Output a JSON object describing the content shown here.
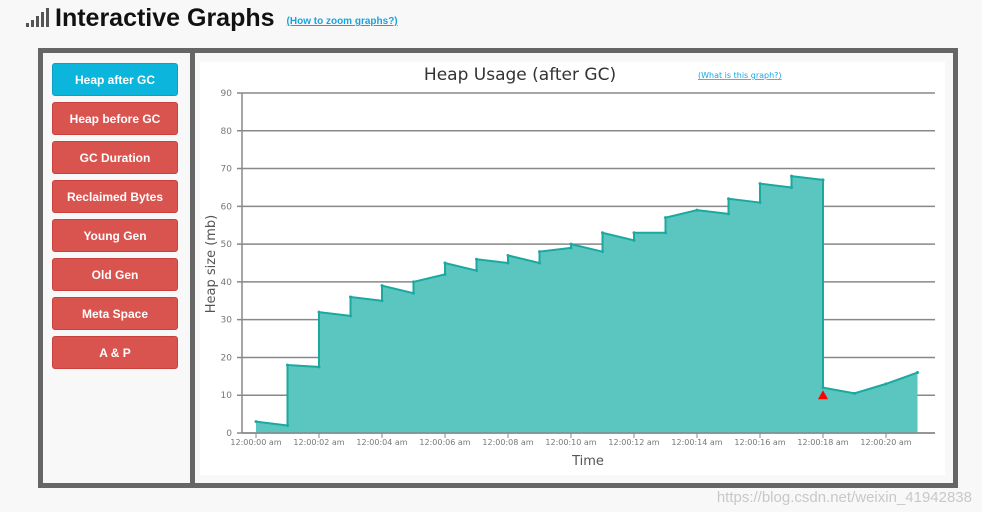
{
  "header": {
    "title": "Interactive Graphs",
    "help_link": "(How to zoom graphs?)"
  },
  "sidebar": {
    "items": [
      {
        "label": "Heap after GC",
        "active": true
      },
      {
        "label": "Heap before GC"
      },
      {
        "label": "GC Duration"
      },
      {
        "label": "Reclaimed Bytes"
      },
      {
        "label": "Young Gen"
      },
      {
        "label": "Old Gen"
      },
      {
        "label": "Meta Space"
      },
      {
        "label": "A & P"
      }
    ]
  },
  "watermark": "https://blog.csdn.net/weixin_41942838",
  "chart_data": {
    "type": "area",
    "title": "Heap Usage (after GC)",
    "help_link": "(What is this graph?)",
    "xlabel": "Time",
    "ylabel": "Heap size (mb)",
    "ylim": [
      0,
      90
    ],
    "yticks": [
      0,
      10,
      20,
      30,
      40,
      50,
      60,
      70,
      80,
      90
    ],
    "xlim_seconds": [
      0,
      21
    ],
    "xticks": [
      "12:00:00 am",
      "12:00:02 am",
      "12:00:04 am",
      "12:00:06 am",
      "12:00:08 am",
      "12:00:10 am",
      "12:00:12 am",
      "12:00:14 am",
      "12:00:16 am",
      "12:00:18 am",
      "12:00:20 am"
    ],
    "grid": true,
    "color": "#5bc6c0",
    "line_color": "#1aa9a0",
    "marker_color": "#ff0000",
    "series": [
      {
        "points": [
          [
            0,
            3
          ],
          [
            1,
            2
          ],
          [
            1,
            18
          ],
          [
            2,
            17.5
          ],
          [
            2,
            32
          ],
          [
            3,
            31
          ],
          [
            3,
            36
          ],
          [
            4,
            35
          ],
          [
            4,
            39
          ],
          [
            5,
            37
          ],
          [
            5,
            40
          ],
          [
            6,
            42
          ],
          [
            6,
            45
          ],
          [
            7,
            43
          ],
          [
            7,
            46
          ],
          [
            8,
            45
          ],
          [
            8,
            47
          ],
          [
            9,
            45
          ],
          [
            9,
            48
          ],
          [
            10,
            49
          ],
          [
            10,
            50
          ],
          [
            11,
            48
          ],
          [
            11,
            53
          ],
          [
            12,
            51
          ],
          [
            12,
            53
          ],
          [
            13,
            53
          ],
          [
            13,
            57
          ],
          [
            14,
            59
          ],
          [
            15,
            58
          ],
          [
            15,
            62
          ],
          [
            16,
            61
          ],
          [
            16,
            66
          ],
          [
            17,
            65
          ],
          [
            17,
            68
          ],
          [
            18,
            67
          ],
          [
            18,
            12
          ],
          [
            19,
            10.5
          ],
          [
            20,
            13
          ],
          [
            21,
            16
          ]
        ]
      }
    ],
    "marker": {
      "t": 18,
      "v": 10
    }
  }
}
